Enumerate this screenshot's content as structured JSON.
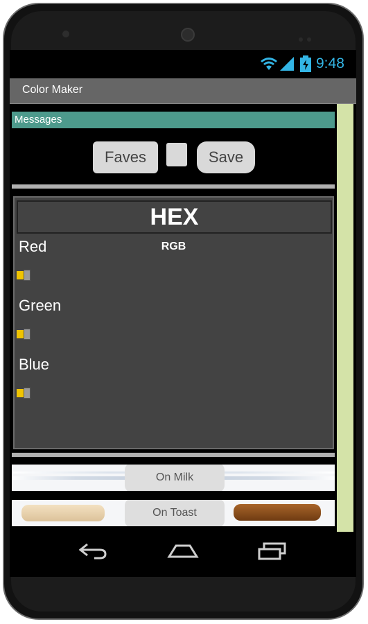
{
  "status_bar": {
    "time": "9:48",
    "icons": [
      "wifi-icon",
      "signal-icon",
      "battery-charging-icon"
    ],
    "accent": "#33b5e5"
  },
  "app": {
    "title": "Color Maker"
  },
  "messages": {
    "label": "Messages"
  },
  "toolbar": {
    "faves_label": "Faves",
    "save_label": "Save"
  },
  "color_panel": {
    "hex_label": "HEX",
    "rgb_label": "RGB",
    "red_label": "Red",
    "green_label": "Green",
    "blue_label": "Blue",
    "red_value": 0,
    "green_value": 0,
    "blue_value": 0
  },
  "previews": {
    "milk_label": "On Milk",
    "toast_label": "On Toast"
  },
  "nav": {
    "icons": [
      "back-icon",
      "home-icon",
      "recents-icon"
    ]
  },
  "colors": {
    "messages_bar": "#4d9a8c",
    "title_bar": "#666666",
    "panel_bg": "#434343",
    "side_strip": "#d4e3a8",
    "slider_thumb": "#f0c400"
  }
}
